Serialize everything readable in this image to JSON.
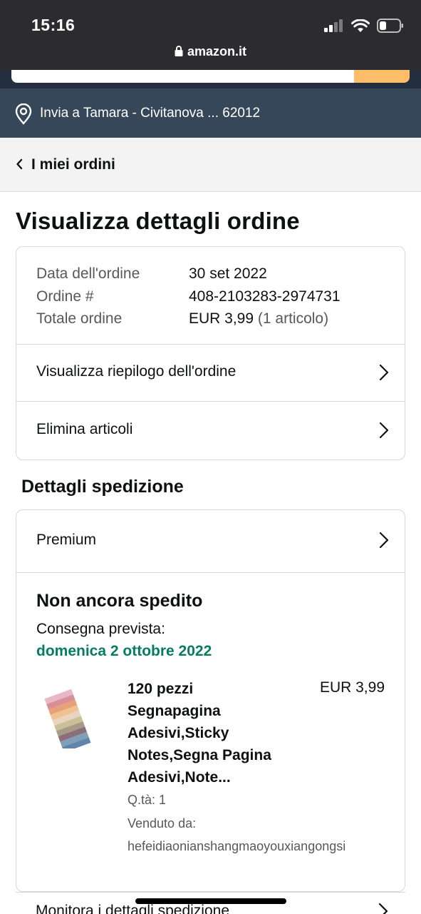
{
  "status_bar": {
    "time": "15:16",
    "url": "amazon.it"
  },
  "delivery": {
    "text": "Invia a Tamara - Civitanova ... 62012"
  },
  "breadcrumb": {
    "label": "I miei ordini"
  },
  "page": {
    "title": "Visualizza dettagli ordine"
  },
  "order_info": {
    "date_label": "Data dell'ordine",
    "date_value": "30 set 2022",
    "number_label": "Ordine #",
    "number_value": "408-2103283-2974731",
    "total_label": "Totale ordine",
    "total_value": "EUR 3,99",
    "total_items": "(1 articolo)"
  },
  "order_links": {
    "summary": "Visualizza riepilogo dell'ordine",
    "delete": "Elimina articoli"
  },
  "shipping": {
    "heading": "Dettagli spedizione",
    "method": "Premium",
    "status": "Non ancora spedito",
    "eta_label": "Consegna prevista:",
    "eta_date": "domenica 2 ottobre 2022",
    "product": {
      "title_lines": [
        "120 pezzi",
        "Segnapagina",
        "Adesivi,Sticky",
        "Notes,Segna Pagina",
        "Adesivi,Note..."
      ],
      "price": "EUR 3,99",
      "qty": "Q.tà: 1",
      "sold_by_label": "Venduto da:",
      "seller": "hefeidiaonianshangmaoyouxiangongsi"
    },
    "next_row_partial": "Monitora i dettagli spedizione"
  },
  "colors": {
    "header_dark": "#232f3e",
    "delivery_bar": "#37475a",
    "eta_green": "#067d62",
    "search_button": "#febd69"
  }
}
